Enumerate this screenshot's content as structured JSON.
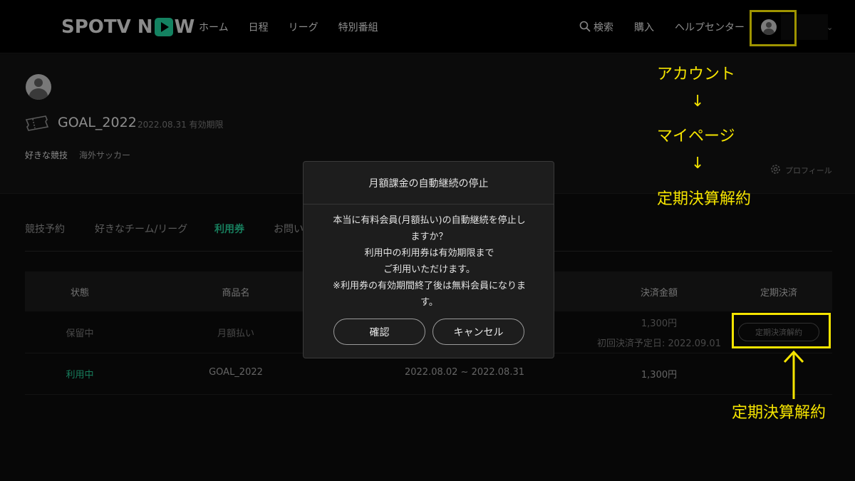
{
  "header": {
    "logo_text_1": "SPOTV N",
    "logo_text_2": "W",
    "nav": [
      "ホーム",
      "日程",
      "リーグ",
      "特別番組"
    ],
    "search_label": "検索",
    "purchase_label": "購入",
    "help_label": "ヘルプセンター"
  },
  "profile": {
    "ticket_name": "GOAL_2022",
    "ticket_expiry": "2022.08.31 有効期限",
    "fav_label": "好きな競技",
    "fav_value": "海外サッカー",
    "profile_link": "プロフィール"
  },
  "tabs": [
    "競技予約",
    "好きなチーム/リーグ",
    "利用券",
    "お問い"
  ],
  "table": {
    "headers": {
      "status": "状態",
      "product": "商品名",
      "amount": "決済金額",
      "subscription": "定期決済"
    },
    "rows": [
      {
        "status": "保留中",
        "product": "月額払い",
        "amount": "1,300円",
        "next_payment": "初回決済予定日: 2022.09.01",
        "action": "定期決済解約"
      },
      {
        "status": "利用中",
        "product": "GOAL_2022",
        "period": "2022.08.02 ~ 2022.08.31",
        "amount": "1,300円"
      }
    ]
  },
  "modal": {
    "title": "月額課金の自動継続の停止",
    "body": "本当に有料会員(月額払い)の自動継続を停止し\nますか？\n利用中の利用券は有効期限まで\nご利用いただけます。\n※利用券の有効期間終了後は無料会員になりま\nす。",
    "confirm": "確認",
    "cancel": "キャンセル"
  },
  "annotations": {
    "step1": "アカウント",
    "arrow1": "↓",
    "step2": "マイページ",
    "arrow2": "↓",
    "step3": "定期決算解約",
    "bottom_label": "定期決算解約"
  },
  "colors": {
    "accent": "#24c08e",
    "annotation": "#f5e400",
    "background": "#0b0b0b"
  }
}
